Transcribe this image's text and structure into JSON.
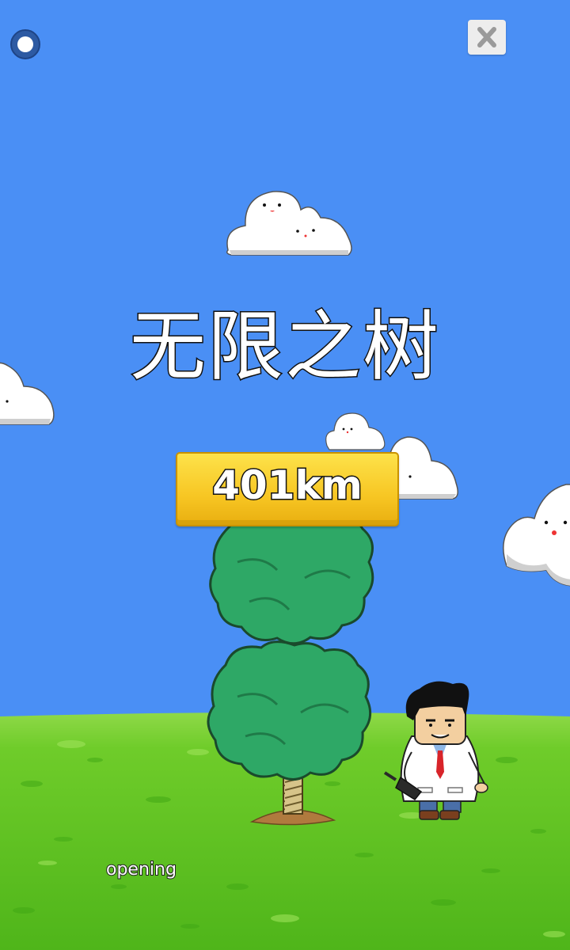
{
  "game": {
    "title": "无限之树",
    "distance": "401km",
    "status": "opening"
  },
  "colors": {
    "sky": "#4a8ff5",
    "grass": "#5fc21e",
    "button": "#f7c623",
    "tree_leaves": "#2ea866",
    "trunk": "#c8b27a"
  },
  "icons": {
    "record": "record-button-icon",
    "close": "close-icon"
  }
}
